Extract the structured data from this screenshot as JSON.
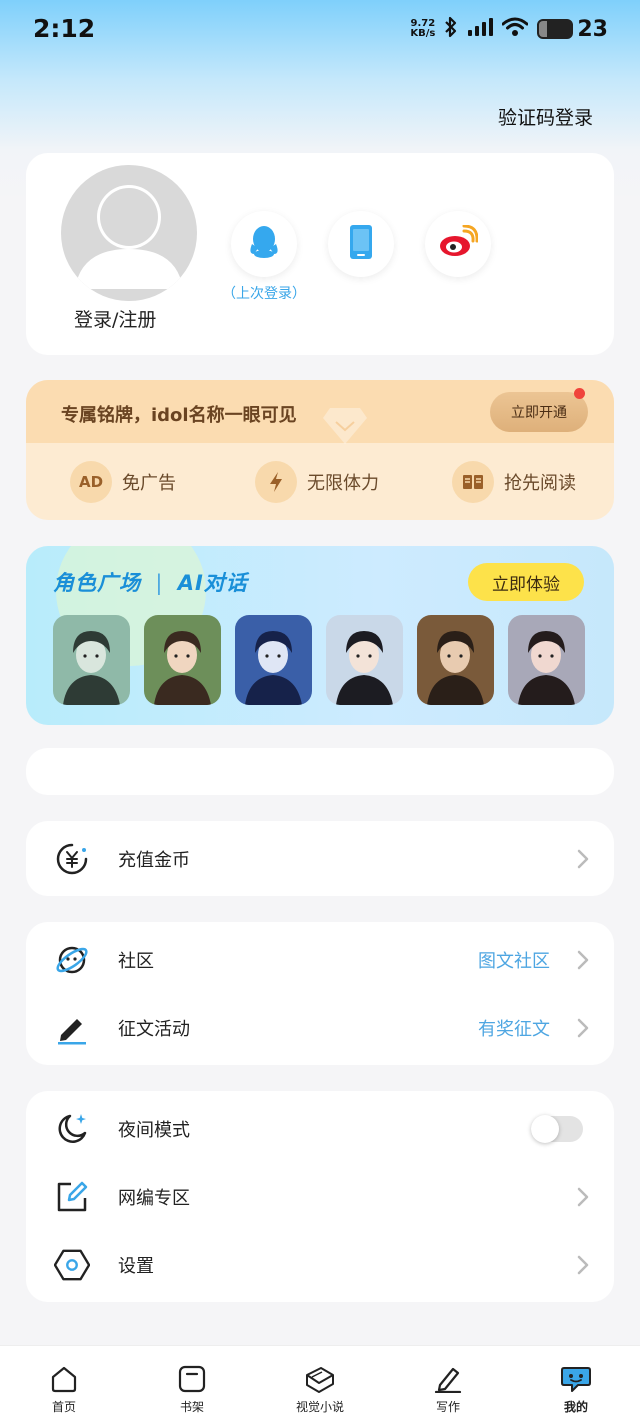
{
  "status_bar": {
    "time": "2:12",
    "net_speed_value": "9.72",
    "net_speed_unit": "KB/s",
    "battery": "23",
    "battery_level": 0.23
  },
  "header": {
    "otp_login": "验证码登录"
  },
  "profile": {
    "login_register": "登录/注册",
    "last_login": "（上次登录）",
    "social_icons": [
      "qq-icon",
      "phone-icon",
      "weibo-icon"
    ]
  },
  "vip": {
    "title": "专属铭牌，idol名称一眼可见",
    "activate_button": "立即开通",
    "perks": [
      {
        "icon_text": "AD",
        "label": "免广告"
      },
      {
        "icon_text": "⚡",
        "label": "无限体力"
      },
      {
        "icon_text": "▤",
        "label": "抢先阅读"
      }
    ]
  },
  "ai_banner": {
    "title_left": "角色广场",
    "title_right": "AI对话",
    "try_button": "立即体验",
    "character_count": 6
  },
  "menu": {
    "recharge": "充值金币",
    "community": "社区",
    "community_extra": "图文社区",
    "contest": "征文活动",
    "contest_extra": "有奖征文",
    "night_mode": "夜间模式",
    "night_mode_on": false,
    "editor_zone": "网编专区",
    "settings": "设置"
  },
  "bottom_nav": [
    {
      "label": "首页",
      "icon": "home-icon"
    },
    {
      "label": "书架",
      "icon": "bookshelf-icon"
    },
    {
      "label": "视觉小说",
      "icon": "visual-novel-icon"
    },
    {
      "label": "写作",
      "icon": "write-icon"
    },
    {
      "label": "我的",
      "icon": "me-icon",
      "active": true
    }
  ],
  "colors": {
    "accent": "#3aa6e8",
    "vip_text": "#6a4422",
    "ai_button": "#fde24a",
    "dot": "#f0443b"
  }
}
